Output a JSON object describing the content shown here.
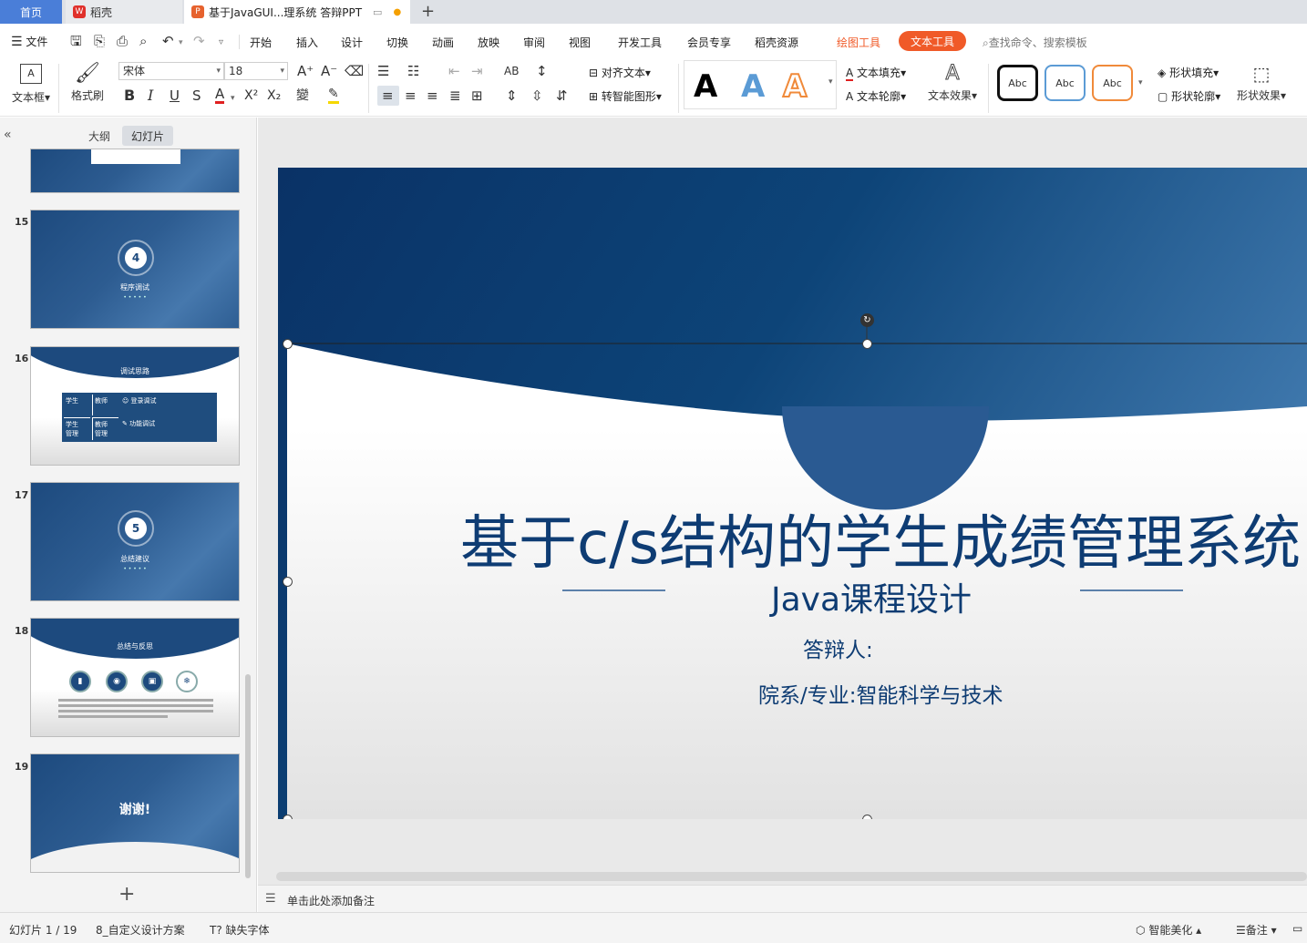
{
  "tabs": {
    "home": "首页",
    "daoke": "稻壳",
    "document": "基于JavaGUI...理系统 答辩PPT",
    "new_tab": "+"
  },
  "menu": {
    "file": "文件",
    "items": [
      "开始",
      "插入",
      "设计",
      "切换",
      "动画",
      "放映",
      "审阅",
      "视图",
      "开发工具",
      "会员专享",
      "稻壳资源"
    ],
    "drawing_tools": "绘图工具",
    "text_tools": "文本工具",
    "search_placeholder": "查找命令、搜索模板"
  },
  "ribbon": {
    "textbox": "文本框",
    "format_painter": "格式刷",
    "font_name": "宋体",
    "font_size": "18",
    "align_text": "对齐文本",
    "convert_smartart": "转智能图形",
    "text_fill": "文本填充",
    "text_outline": "文本轮廓",
    "text_effect": "文本效果",
    "style_sample": "Abc",
    "shape_fill": "形状填充",
    "shape_outline": "形状轮廓",
    "shape_effect": "形状效果",
    "bold": "B",
    "italic": "I",
    "underline": "U",
    "strike": "S",
    "font_color": "A",
    "superscript": "X²",
    "subscript": "X₂"
  },
  "panel": {
    "outline_tab": "大纲",
    "slides_tab": "幻灯片",
    "add_slide": "+"
  },
  "thumbnails": [
    {
      "num": "15",
      "circle": "4",
      "title": "程序调试"
    },
    {
      "num": "16",
      "title": "调试思路",
      "cells": [
        "学生",
        "教师",
        "学生\n管理",
        "教师\n管理"
      ],
      "item1": "登录调试",
      "item2": "功能调试"
    },
    {
      "num": "17",
      "circle": "5",
      "title": "总结建议"
    },
    {
      "num": "18",
      "title": "总结与反思"
    },
    {
      "num": "19",
      "title": "谢谢!"
    }
  ],
  "slide": {
    "title": "基于c/s结构的学生成绩管理系统",
    "subtitle": "Java课程设计",
    "presenter": "答辩人:",
    "department": "院系/专业:智能科学与技术"
  },
  "notes_placeholder": "单击此处添加备注",
  "status": {
    "slide_count": "幻灯片 1 / 19",
    "design": "8_自定义设计方案",
    "missing_font": "缺失字体",
    "smart_beautify": "智能美化",
    "notes": "备注"
  },
  "colors": {
    "accent_blue": "#4a7ed8",
    "text_tools_orange": "#f05a28",
    "slide_blue": "#0d3b6e",
    "title_blue": "#0e3c73"
  }
}
